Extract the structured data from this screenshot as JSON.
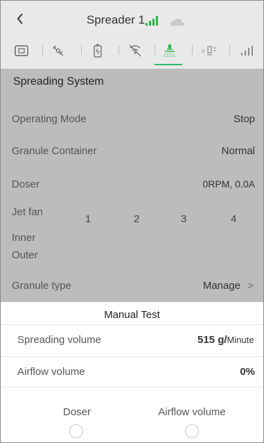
{
  "header": {
    "back_icon": "chevron-left-icon",
    "title": "Spreader 1",
    "signal_color": "#2db54a",
    "cloud_color": "#c9c9c9"
  },
  "tabs": [
    {
      "icon": "device-icon"
    },
    {
      "icon": "satellite-icon"
    },
    {
      "icon": "battery-icon"
    },
    {
      "icon": "no-signal-icon"
    },
    {
      "icon": "spreader-icon",
      "active": true
    },
    {
      "icon": "radar-icon",
      "label": "0"
    },
    {
      "icon": "signal-icon"
    }
  ],
  "spreading": {
    "title": "Spreading System",
    "operating_mode_label": "Operating Mode",
    "operating_mode_value": "Stop",
    "granule_container_label": "Granule Container",
    "granule_container_value": "Normal",
    "doser_label": "Doser",
    "doser_value": "0RPM, 0.0A",
    "jet_fan_label": "Jet fan",
    "fan_numbers": [
      "1",
      "2",
      "3",
      "4"
    ],
    "inner_label": "Inner",
    "outer_label": "Outer",
    "granule_type_label": "Granule type",
    "granule_type_value": "Manage",
    "granule_type_arrow": ">"
  },
  "manual_test": {
    "title": "Manual Test",
    "spreading_volume_label": "Spreading volume",
    "spreading_volume_value": "515 g/",
    "spreading_volume_unit": "Minute",
    "airflow_volume_label": "Airflow volume",
    "airflow_volume_value": "0%",
    "doser_button_label": "Doser",
    "airflow_button_label": "Airflow volume"
  }
}
